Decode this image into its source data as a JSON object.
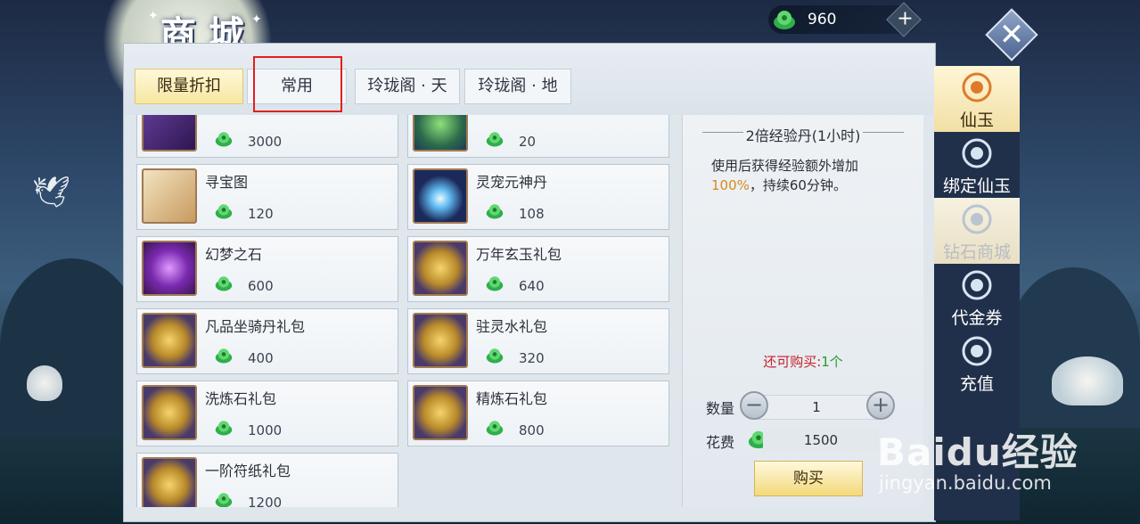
{
  "header": {
    "title": "商城",
    "currency_value": "960",
    "plus_label": "+",
    "close_label": "✕"
  },
  "tabs": [
    {
      "label": "限量折扣",
      "active": true
    },
    {
      "label": "常用",
      "active": false
    },
    {
      "label": "玲珑阁 · 天",
      "active": false
    },
    {
      "label": "玲珑阁 · 地",
      "active": false
    }
  ],
  "items": [
    {
      "name": "",
      "price": "3000",
      "icon": "purple-relic-icon"
    },
    {
      "name": "",
      "price": "20",
      "icon": "green-orb-icon"
    },
    {
      "name": "寻宝图",
      "price": "120",
      "icon": "treasure-map-icon"
    },
    {
      "name": "灵宠元神丹",
      "price": "108",
      "icon": "spirit-drop-icon"
    },
    {
      "name": "幻梦之石",
      "price": "600",
      "icon": "purple-crystal-icon"
    },
    {
      "name": "万年玄玉礼包",
      "price": "640",
      "icon": "gold-chest-icon"
    },
    {
      "name": "凡品坐骑丹礼包",
      "price": "400",
      "icon": "gold-chest-icon"
    },
    {
      "name": "驻灵水礼包",
      "price": "320",
      "icon": "gold-chest-icon"
    },
    {
      "name": "洗炼石礼包",
      "price": "1000",
      "icon": "gold-chest-icon"
    },
    {
      "name": "精炼石礼包",
      "price": "800",
      "icon": "gold-chest-icon"
    },
    {
      "name": "一阶符纸礼包",
      "price": "1200",
      "icon": "gold-chest-icon"
    }
  ],
  "detail": {
    "title": "2倍经验丹(1小时)",
    "desc_prefix": "使用后获得经验额外增加",
    "desc_pct": "100%",
    "desc_suffix": "，持续60分钟。",
    "remain_label": "还可购买:",
    "remain_count": "1个",
    "qty_label": "数量",
    "qty_value": "1",
    "minus": "−",
    "plus": "+",
    "cost_label": "花费",
    "cost_value": "1500",
    "buy_label": "购买"
  },
  "sidebar": [
    {
      "label": "仙玉",
      "icon": "jade-coin-icon",
      "state": "active"
    },
    {
      "label": "绑定仙玉",
      "icon": "bound-jade-icon",
      "state": "normal"
    },
    {
      "label": "钻石商城",
      "icon": "diamond-shop-icon",
      "state": "faded"
    },
    {
      "label": "代金券",
      "icon": "voucher-icon",
      "state": "normal"
    },
    {
      "label": "充值",
      "icon": "recharge-icon",
      "state": "normal"
    }
  ],
  "watermark": {
    "main": "Baidu经验",
    "url": "jingyan.baidu.com"
  },
  "colors": {
    "accent_gold": "#f3d97a",
    "price_green": "#3db84a",
    "warning_red": "#c8202a",
    "highlight_red": "#e02020"
  }
}
